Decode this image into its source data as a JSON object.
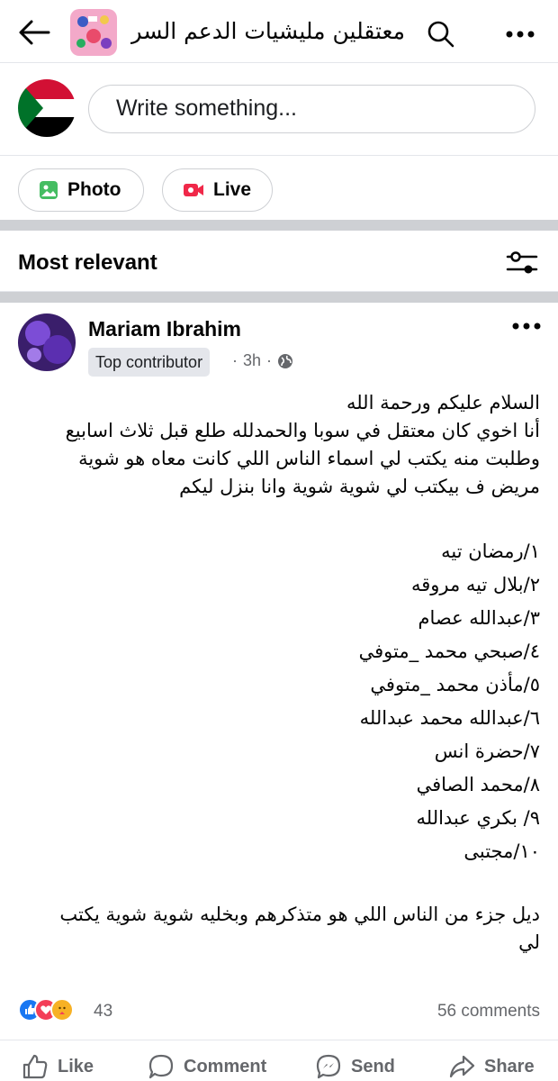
{
  "header": {
    "title": "معتقلين مليشيات الدعم السر...",
    "icons": {
      "back": "arrow-left-icon",
      "search": "search-icon",
      "more": "more-dots-icon"
    }
  },
  "composer": {
    "placeholder": "Write something...",
    "photo_label": "Photo",
    "live_label": "Live"
  },
  "sort": {
    "label": "Most relevant"
  },
  "post": {
    "author": "Mariam Ibrahim",
    "badge": "Top contributor",
    "time": "3h",
    "body": {
      "intro": [
        "السلام عليكم ورحمة الله",
        "أنا اخوي كان معتقل في سوبا والحمدلله طلع قبل ثلاث اسابيع",
        "وطلبت منه يكتب لي اسماء الناس اللي كانت معاه هو شوية",
        "مريض ف بيكتب لي شوية شوية وانا بنزل ليكم"
      ],
      "list": [
        "١/رمضان تيه",
        "٢/بلال تيه مروقه",
        "٣/عبدالله عصام",
        "٤/صبحي محمد _متوفي",
        "٥/مأذن محمد _متوفي",
        "٦/عبدالله محمد عبدالله",
        "٧/حضرة انس",
        "٨/محمد الصافي",
        "٩/ بكري عبدالله",
        "١٠/مجتبى"
      ],
      "outro": [
        "ديل جزء من الناس اللي هو متذكرهم وبخليه شوية شوية يكتب",
        "لي"
      ]
    },
    "reaction_count": "43",
    "comments": "56 comments"
  },
  "actions": {
    "like": "Like",
    "comment": "Comment",
    "send": "Send",
    "share": "Share"
  },
  "colors": {
    "border": "#ced0d4",
    "muted": "#65676b",
    "like_blue": "#1877f2",
    "love_red": "#f33e58",
    "care_yellow": "#f7b125"
  }
}
